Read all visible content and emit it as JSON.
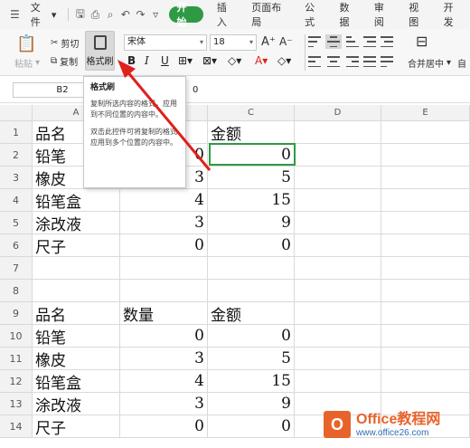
{
  "menu": {
    "file_label": "文件",
    "tabs": [
      "开始",
      "插入",
      "页面布局",
      "公式",
      "数据",
      "审阅",
      "视图",
      "开发"
    ]
  },
  "ribbon": {
    "paste_label": "粘贴",
    "cut_label": "剪切",
    "copy_label": "复制",
    "format_painter_label": "格式刷",
    "font_name": "宋体",
    "font_size": "18",
    "bold": "B",
    "italic": "I",
    "underline": "U",
    "font_color_letter": "A",
    "merge_label": "合并居中",
    "auto_label": "自"
  },
  "formula_bar": {
    "cell_ref": "B2",
    "value": "0"
  },
  "tooltip": {
    "title": "格式刷",
    "para1": "复制所选内容的格式，应用到不同位置的内容中。",
    "para2": "双击此控件可将复制的格式应用到多个位置的内容中。"
  },
  "grid": {
    "columns": [
      "A",
      "B",
      "C",
      "D",
      "E"
    ],
    "row_numbers": [
      "1",
      "2",
      "3",
      "4",
      "5",
      "6",
      "7",
      "8",
      "9",
      "10",
      "11",
      "12",
      "13",
      "14"
    ],
    "rows": [
      [
        "品名",
        "",
        "金额"
      ],
      [
        "铅笔",
        "0",
        "0"
      ],
      [
        "橡皮",
        "3",
        "5"
      ],
      [
        "铅笔盒",
        "4",
        "15"
      ],
      [
        "涂改液",
        "3",
        "9"
      ],
      [
        "尺子",
        "0",
        "0"
      ],
      [
        "",
        "",
        ""
      ],
      [
        "",
        "",
        ""
      ],
      [
        "品名",
        "数量",
        "金额"
      ],
      [
        "铅笔",
        "0",
        "0"
      ],
      [
        "橡皮",
        "3",
        "5"
      ],
      [
        "铅笔盒",
        "4",
        "15"
      ],
      [
        "涂改液",
        "3",
        "9"
      ],
      [
        "尺子",
        "0",
        "0"
      ]
    ]
  },
  "watermark": {
    "brand": "Office教程网",
    "url": "www.office26.com"
  },
  "colors": {
    "accent": "#2e9a44",
    "arrow": "#e0201b",
    "watermark_orange": "#e8632b"
  }
}
